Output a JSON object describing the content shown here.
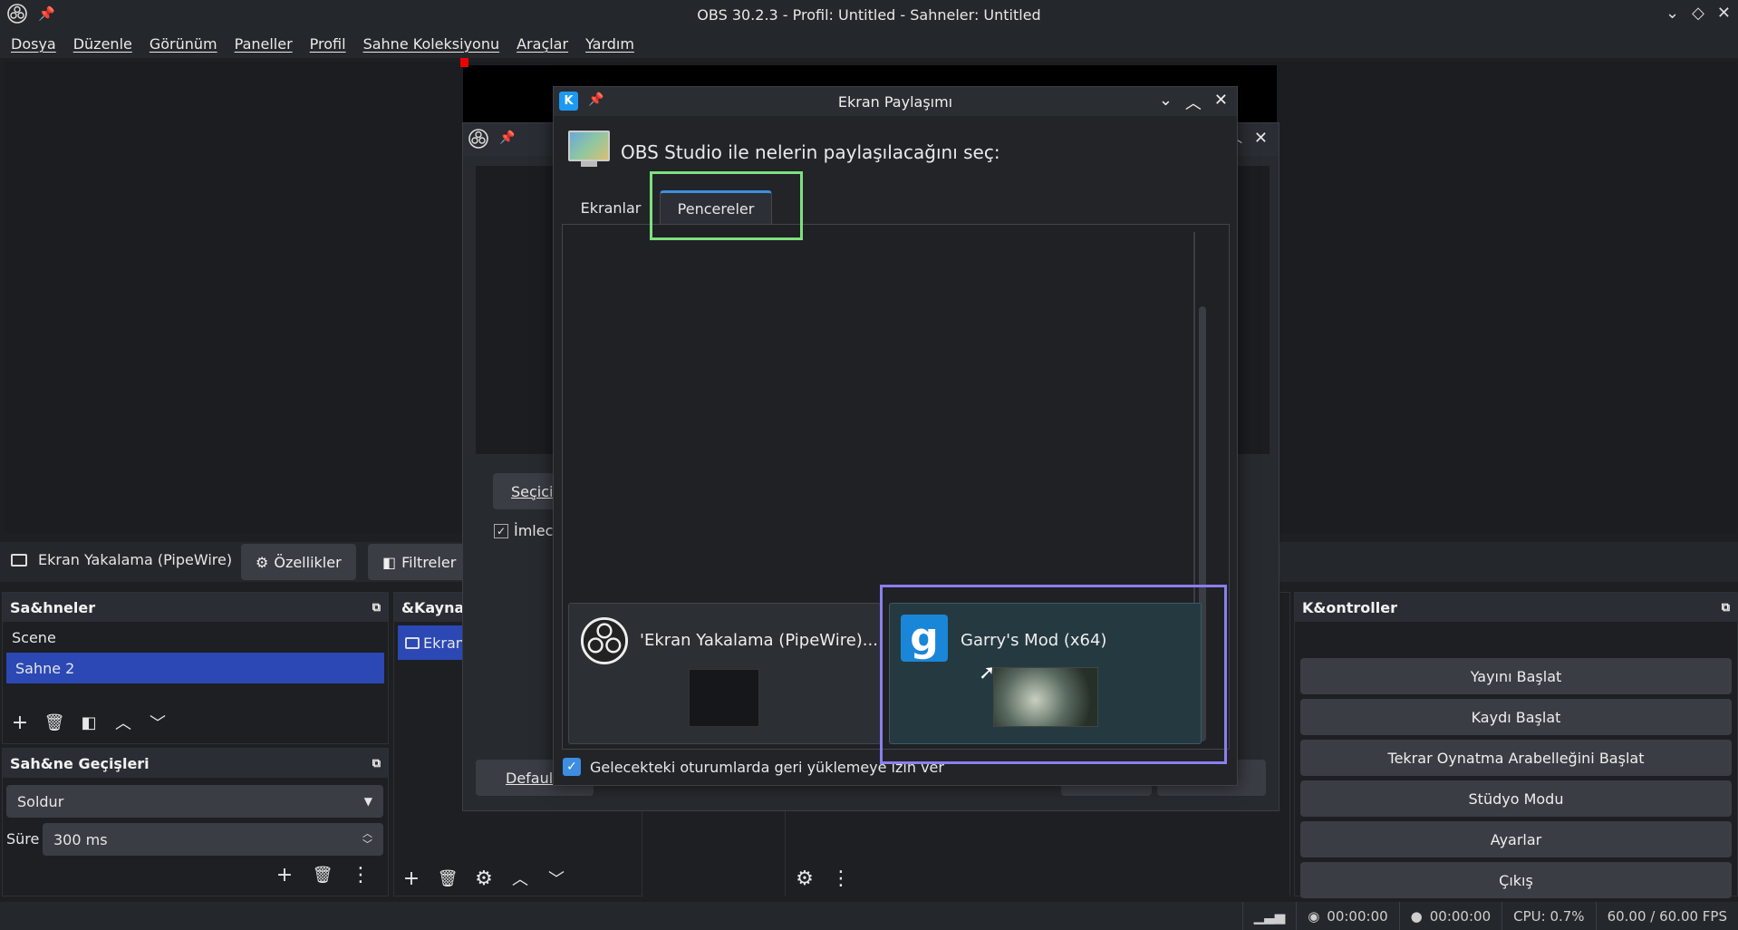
{
  "window": {
    "title": "OBS 30.2.3 - Profil: Untitled - Sahneler: Untitled"
  },
  "menu": [
    "Dosya",
    "Düzenle",
    "Görünüm",
    "Paneller",
    "Profil",
    "Sahne Koleksiyonu",
    "Araçlar",
    "Yardım"
  ],
  "source_toolbar": {
    "source_name": "Ekran Yakalama (PipeWire)",
    "properties_label": "Özellikler",
    "filters_label": "Filtreler"
  },
  "scenes_dock": {
    "title": "Sa&hneler",
    "items": [
      "Scene",
      "Sahne 2"
    ],
    "selected": "Sahne 2"
  },
  "sources_dock": {
    "title": "&Kaynak",
    "item": "Ekran"
  },
  "transitions_dock": {
    "title": "Sah&ne Geçişleri",
    "transition": "Soldur",
    "duration_label": "Süre",
    "duration_value": "300 ms"
  },
  "controls_dock": {
    "title": "K&ontroller",
    "buttons": [
      "Yayını Başlat",
      "Kaydı Başlat",
      "Tekrar Oynatma Arabelleğini Başlat",
      "Stüdyo Modu",
      "Ayarlar",
      "Çıkış"
    ]
  },
  "properties_dialog": {
    "select_label": "Seçiciy",
    "cursor_label": "İmlec",
    "defaults_label": "Default"
  },
  "share_dialog": {
    "title": "Ekran Paylaşımı",
    "prompt": "OBS Studio ile nelerin paylaşılacağını seç:",
    "tabs": [
      "Ekranlar",
      "Pencereler"
    ],
    "active_tab": "Pencereler",
    "windows": [
      {
        "label": "'Ekran Yakalama (PipeWire)...",
        "selected": false
      },
      {
        "label": "Garry's Mod (x64)",
        "selected": true
      }
    ],
    "allow_restore_label": "Gelecekteki oturumlarda geri yüklemeye izin ver",
    "allow_restore_checked": true
  },
  "status": {
    "stream_time": "00:00:00",
    "rec_time": "00:00:00",
    "cpu": "CPU: 0.7%",
    "fps": "60.00 / 60.00 FPS"
  },
  "colors": {
    "accent_selected": "#2b48b4",
    "tab_highlight": "#3d8ee0",
    "annotation_green": "#7ee07e",
    "annotation_purple": "#8a7ff0"
  }
}
